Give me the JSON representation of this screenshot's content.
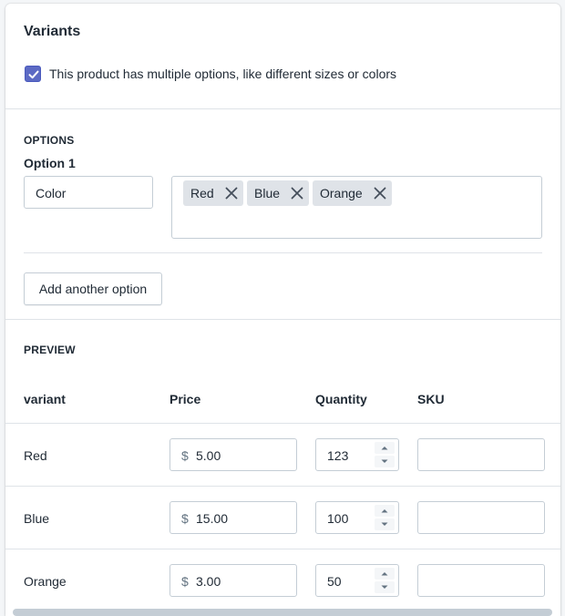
{
  "card": {
    "title": "Variants",
    "multiple_options_checkbox": {
      "checked": true,
      "label": "This product has multiple options, like different sizes or colors"
    }
  },
  "options": {
    "heading": "OPTIONS",
    "option1_label": "Option 1",
    "option1_name": "Color",
    "values": [
      "Red",
      "Blue",
      "Orange"
    ],
    "add_button": "Add another option"
  },
  "preview": {
    "heading": "PREVIEW",
    "columns": [
      "variant",
      "Price",
      "Quantity",
      "SKU"
    ],
    "currency_symbol": "$",
    "rows": [
      {
        "variant": "Red",
        "price": "5.00",
        "quantity": "123",
        "sku": ""
      },
      {
        "variant": "Blue",
        "price": "15.00",
        "quantity": "100",
        "sku": ""
      },
      {
        "variant": "Orange",
        "price": "3.00",
        "quantity": "50",
        "sku": ""
      }
    ]
  },
  "colors": {
    "accent": "#5c6ac4",
    "border": "#c4cdd5",
    "tag_bg": "#dfe3e8"
  },
  "icons": {
    "checkbox": "checkmark-icon",
    "tag_remove": "close-icon",
    "stepper": [
      "chevron-up-icon",
      "chevron-down-icon"
    ]
  }
}
